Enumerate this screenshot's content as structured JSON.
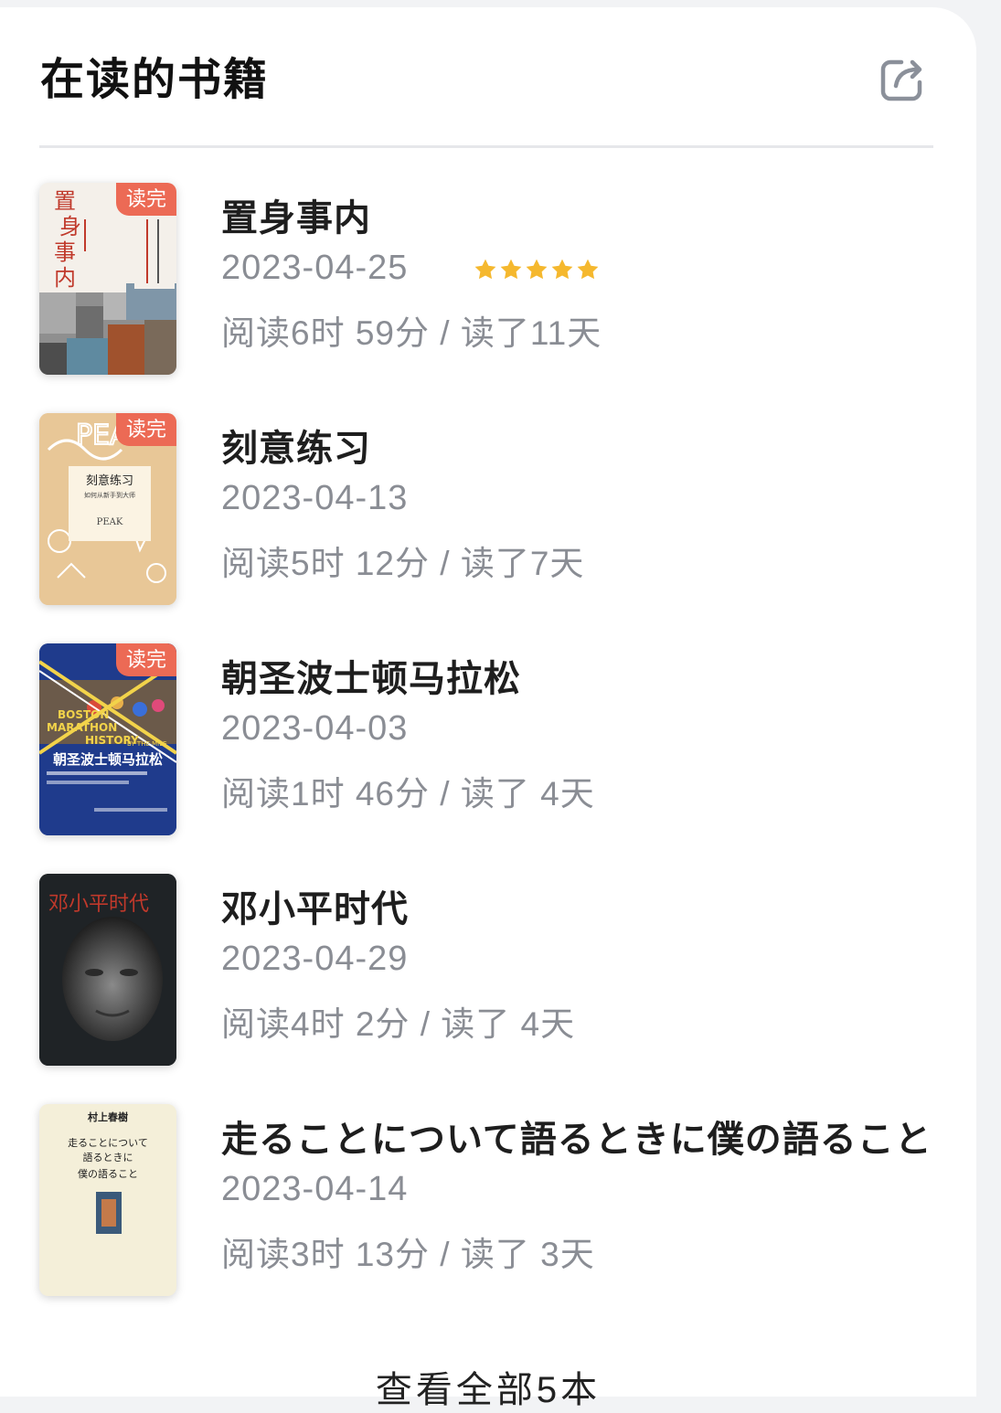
{
  "header": {
    "title": "在读的书籍",
    "share_icon": "share-icon"
  },
  "books": [
    {
      "title": "置身事内",
      "date": "2023-04-25",
      "stats": "阅读6时 59分 / 读了11天",
      "badge": "读完",
      "rating": 5,
      "cover": {
        "lines": [
          "置",
          "身",
          "事",
          "内"
        ],
        "accent": "#c0392b"
      }
    },
    {
      "title": "刻意练习",
      "date": "2023-04-13",
      "stats": "阅读5时 12分 / 读了7天",
      "badge": "读完",
      "cover": {
        "title": "刻意练习",
        "subtitle": "如何从新手到大师",
        "en": "PEAK"
      }
    },
    {
      "title": "朝圣波士顿马拉松",
      "date": "2023-04-03",
      "stats": "阅读1时 46分 / 读了 4天",
      "badge": "读完",
      "cover": {
        "en1": "BOSTON",
        "en2": "MARATHON",
        "en3": "HISTORY",
        "en4": "BY THE MILE",
        "title": "朝圣波士顿马拉松"
      }
    },
    {
      "title": "邓小平时代",
      "date": "2023-04-29",
      "stats": "阅读4时 2分 / 读了 4天",
      "cover": {
        "title": "邓小平时代"
      }
    },
    {
      "title": "走ることについて語るときに僕の語ること",
      "date": "2023-04-14",
      "stats": "阅读3时 13分 / 读了 3天",
      "cover": {
        "author": "村上春樹",
        "title_lines": [
          "走ることについて",
          "語るときに",
          "僕の語ること"
        ]
      }
    }
  ],
  "footer": {
    "more_label": "查看全部5本"
  },
  "colors": {
    "badge": "#ec6a55",
    "star": "#f5b82e",
    "muted_text": "#8a8d94"
  }
}
